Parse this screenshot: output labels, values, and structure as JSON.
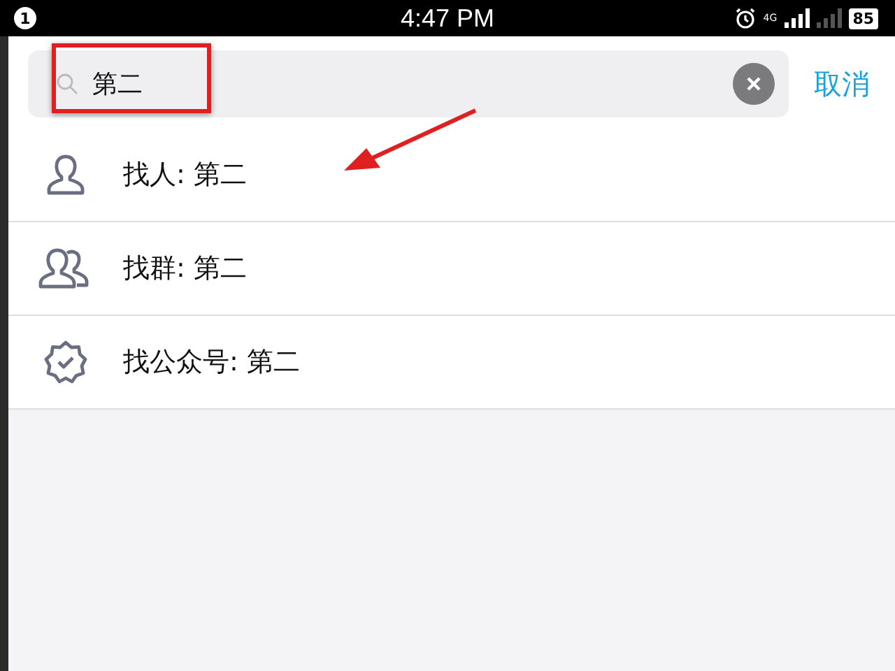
{
  "status_bar": {
    "notification_count": "1",
    "time": "4:47 PM",
    "network": "4G",
    "battery": "85"
  },
  "search": {
    "value": "第二",
    "cancel": "取消"
  },
  "results": [
    {
      "kind": "person",
      "label": "找人: 第二"
    },
    {
      "kind": "group",
      "label": "找群: 第二"
    },
    {
      "kind": "official",
      "label": "找公众号: 第二"
    }
  ]
}
